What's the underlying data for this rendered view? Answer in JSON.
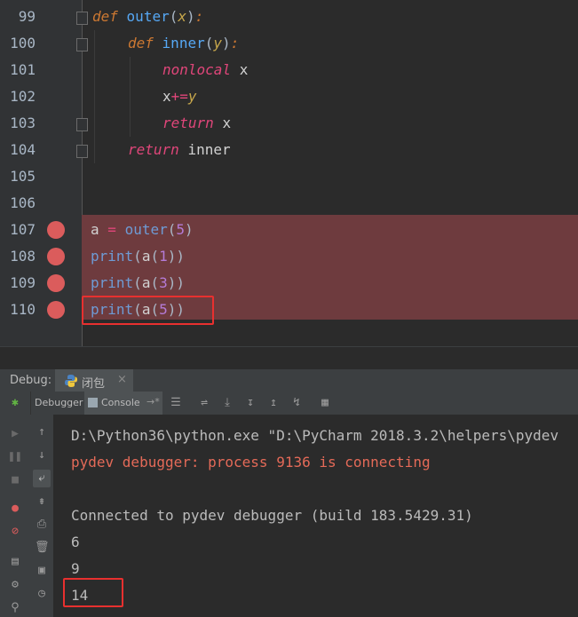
{
  "editor": {
    "lines": [
      {
        "num": "99"
      },
      {
        "num": "100"
      },
      {
        "num": "101"
      },
      {
        "num": "102"
      },
      {
        "num": "103"
      },
      {
        "num": "104"
      },
      {
        "num": "105"
      },
      {
        "num": "106"
      },
      {
        "num": "107"
      },
      {
        "num": "108"
      },
      {
        "num": "109"
      },
      {
        "num": "110"
      }
    ],
    "tokens": {
      "def": "def",
      "outer": "outer",
      "lparen": "(",
      "x": "x",
      "rparen": ")",
      "colon": ":",
      "inner": "inner",
      "y": "y",
      "nonlocal": "nonlocal",
      "x2": "x",
      "xvar": "x",
      "pluseq": "+=",
      "y2": "y",
      "return": "return",
      "x3": "x",
      "inner2": "inner",
      "a": "a",
      "eq": "=",
      "five": "5",
      "print": "print",
      "one": "1",
      "three": "3"
    }
  },
  "debug": {
    "label": "Debug:",
    "session": "闭包",
    "tabs": [
      "Debugger",
      "Console"
    ]
  },
  "console": {
    "lines": [
      "D:\\Python36\\python.exe \"D:\\PyCharm 2018.3.2\\helpers\\pydev",
      "pydev debugger: process 9136 is connecting",
      "",
      "Connected to pydev debugger (build 183.5429.31)",
      "6",
      "9",
      "14"
    ]
  },
  "colors": {
    "breakpoint": "#db5c5c",
    "highlight_box": "#e8302f",
    "error_text": "#e46a58"
  },
  "icons": [
    "resume-icon",
    "pause-icon",
    "stop-icon",
    "view-breakpoints-icon",
    "mute-breakpoints-icon",
    "layout-icon",
    "settings-icon",
    "pin-icon",
    "up-arrow-icon",
    "down-arrow-icon",
    "soft-wrap-icon",
    "scroll-end-icon",
    "print-icon",
    "trash-icon",
    "python-icon",
    "bug-icon"
  ]
}
